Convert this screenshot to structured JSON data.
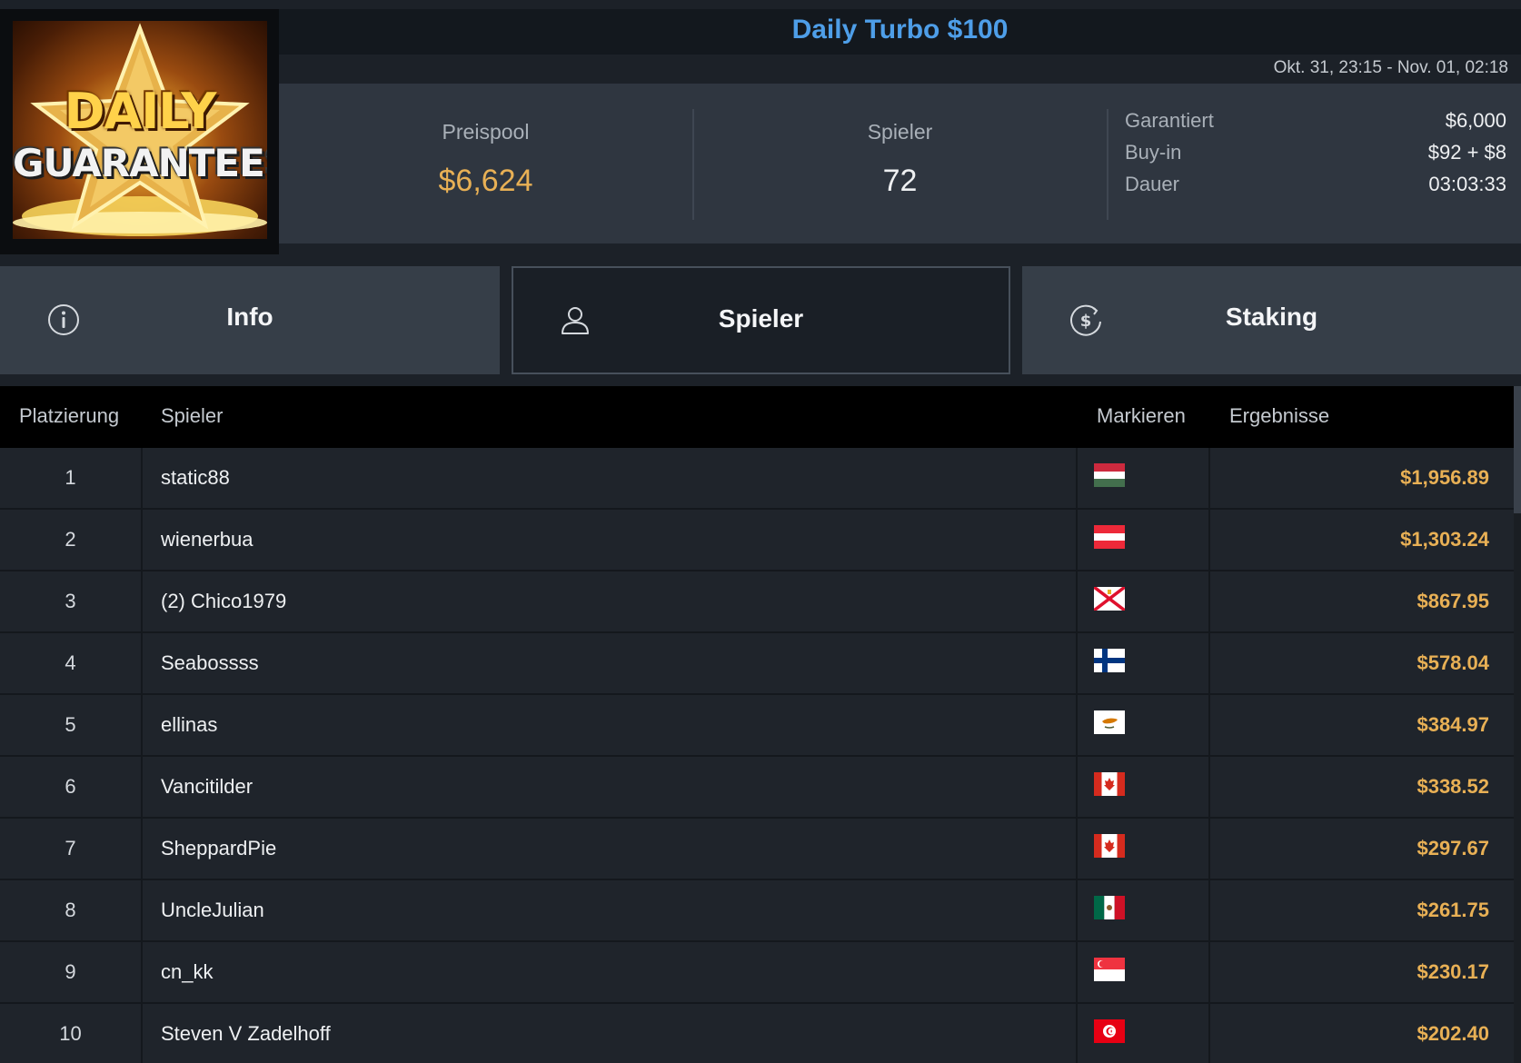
{
  "logo": {
    "line1": "DAILY",
    "line2": "GUARANTEES"
  },
  "header": {
    "title": "Daily Turbo $100",
    "date_range": "Okt. 31, 23:15 - Nov. 01, 02:18"
  },
  "stats": {
    "prize_pool_label": "Preispool",
    "prize_pool_value": "$6,624",
    "players_label": "Spieler",
    "players_value": "72",
    "guaranteed_label": "Garantiert",
    "guaranteed_value": "$6,000",
    "buyin_label": "Buy-in",
    "buyin_value": "$92 + $8",
    "duration_label": "Dauer",
    "duration_value": "03:03:33"
  },
  "tabs": [
    {
      "label": "Info",
      "icon": "info-icon",
      "active": false
    },
    {
      "label": "Spieler",
      "icon": "user-icon",
      "active": true
    },
    {
      "label": "Staking",
      "icon": "dollar-coin-icon",
      "active": false
    }
  ],
  "table": {
    "headers": {
      "rank": "Platzierung",
      "player": "Spieler",
      "flag": "Markieren",
      "result": "Ergebnisse"
    },
    "rows": [
      {
        "rank": "1",
        "player": "static88",
        "flag": "hungary",
        "result": "$1,956.89"
      },
      {
        "rank": "2",
        "player": "wienerbua",
        "flag": "austria",
        "result": "$1,303.24"
      },
      {
        "rank": "3",
        "player": "(2) Chico1979",
        "flag": "jersey",
        "result": "$867.95"
      },
      {
        "rank": "4",
        "player": "Seabossss",
        "flag": "finland",
        "result": "$578.04"
      },
      {
        "rank": "5",
        "player": "ellinas",
        "flag": "cyprus",
        "result": "$384.97"
      },
      {
        "rank": "6",
        "player": "Vancitilder",
        "flag": "canada",
        "result": "$338.52"
      },
      {
        "rank": "7",
        "player": "SheppardPie",
        "flag": "canada",
        "result": "$297.67"
      },
      {
        "rank": "8",
        "player": "UncleJulian",
        "flag": "mexico",
        "result": "$261.75"
      },
      {
        "rank": "9",
        "player": "cn_kk",
        "flag": "singapore",
        "result": "$230.17"
      },
      {
        "rank": "10",
        "player": "Steven V Zadelhoff",
        "flag": "tunisia",
        "result": "$202.40"
      }
    ]
  },
  "colors": {
    "title_blue": "#4e9ee8",
    "gold": "#e8b055",
    "tab_active_bg": "#1a1f26",
    "tab_bg": "#363e48"
  }
}
